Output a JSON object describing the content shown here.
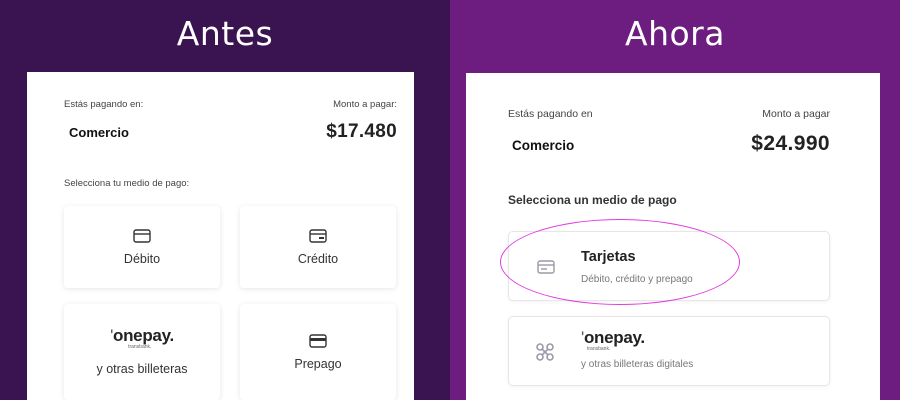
{
  "before": {
    "heading": "Antes",
    "paying_in_label": "Estás pagando en:",
    "amount_label": "Monto a pagar:",
    "merchant": "Comercio",
    "amount": "$17.480",
    "select_prompt": "Selecciona tu medio de pago:",
    "options": [
      {
        "label": "Débito",
        "icon": "card-icon"
      },
      {
        "label": "Crédito",
        "icon": "credit-card-icon"
      },
      {
        "label": "y otras billeteras",
        "logo": "onepay",
        "logo_sub": "transbank."
      },
      {
        "label": "Prepago",
        "icon": "prepaid-card-icon"
      }
    ]
  },
  "after": {
    "heading": "Ahora",
    "paying_in_label": "Estás pagando en",
    "amount_label": "Monto a pagar",
    "merchant": "Comercio",
    "amount": "$24.990",
    "select_prompt": "Selecciona un medio de pago",
    "options": [
      {
        "title": "Tarjetas",
        "subtitle": "Débito, crédito y prepago",
        "icon": "card-icon",
        "highlighted": true
      },
      {
        "logo": "onepay",
        "logo_sub": "transbank.",
        "subtitle": "y otras billeteras digitales",
        "icon": "wallet-icon"
      }
    ]
  },
  "colors": {
    "before_bg": "#3a1450",
    "after_bg": "#6d1c80",
    "highlight": "#e23be0",
    "icon_gray": "#9a9aa8"
  }
}
